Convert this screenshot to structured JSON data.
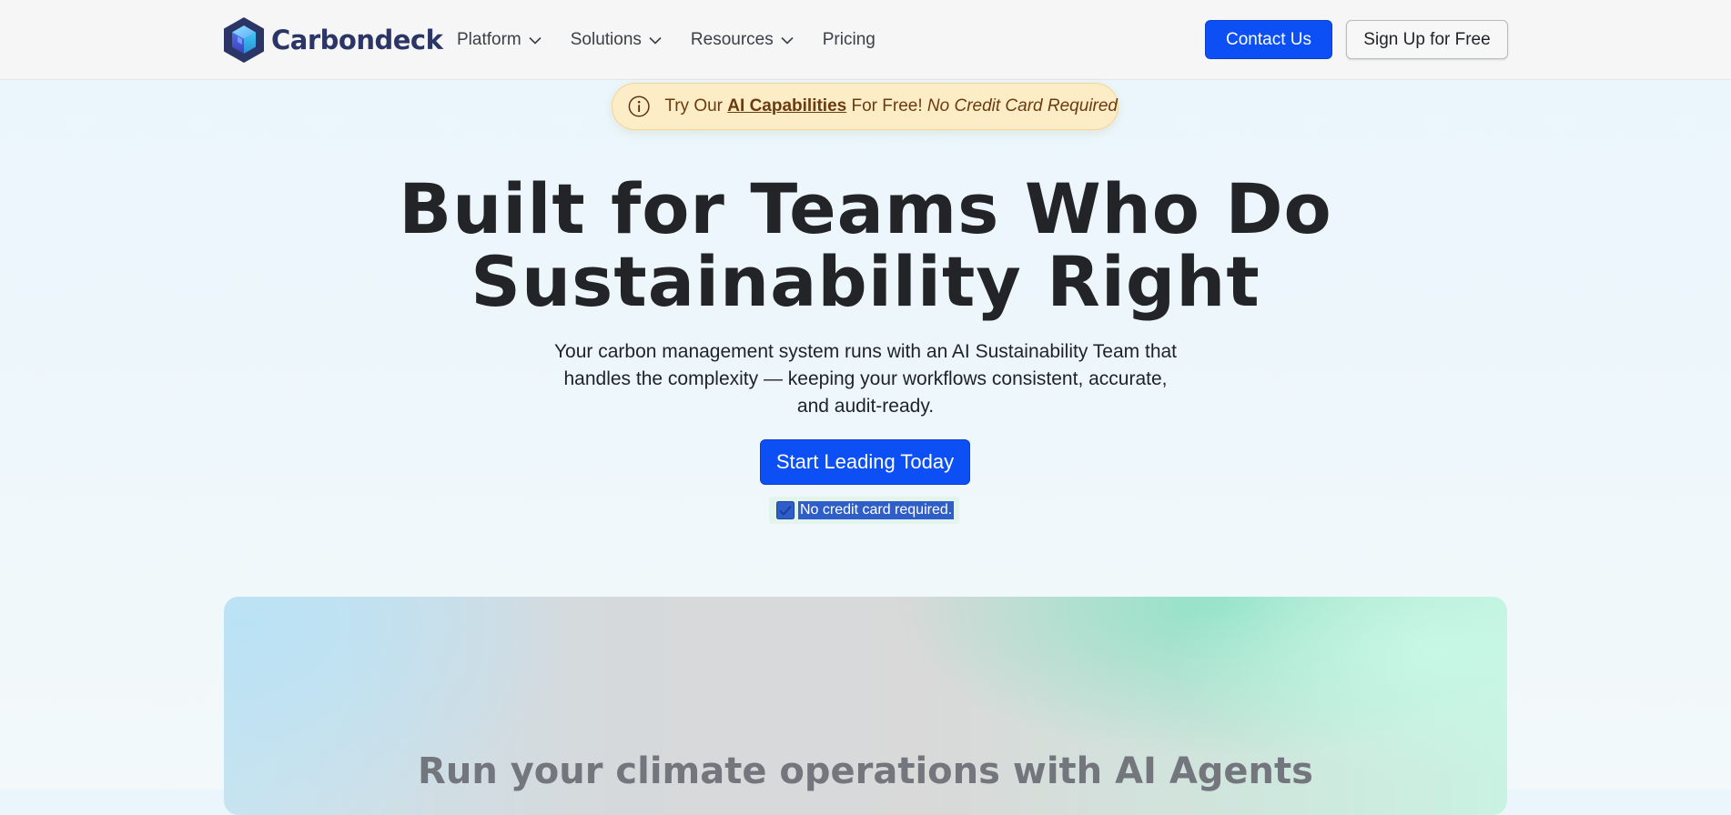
{
  "brand": {
    "name": "Carbondeck",
    "icon": "hexagon-cube-logo"
  },
  "nav": {
    "items": [
      {
        "label": "Platform",
        "has_dropdown": true
      },
      {
        "label": "Solutions",
        "has_dropdown": true
      },
      {
        "label": "Resources",
        "has_dropdown": true
      },
      {
        "label": "Pricing",
        "has_dropdown": false
      }
    ],
    "contact_label": "Contact Us",
    "signup_label": "Sign Up for Free"
  },
  "announcement": {
    "icon": "info-icon",
    "prefix": "Try Our ",
    "link": "AI Capabilities",
    "middle": " For Free! ",
    "emphasis": "No Credit Card Required"
  },
  "hero": {
    "title_line1": "Built for Teams Who Do",
    "title_line2": "Sustainability Right",
    "subtitle": "Your carbon management system runs with an AI Sustainability Team that handles the complexity — keeping your workflows consistent, accurate, and audit-ready.",
    "cta_label": "Start Leading Today",
    "note": "No credit card required.",
    "note_icon": "check-icon"
  },
  "showcase": {
    "title": "Run your climate operations with AI Agents"
  },
  "colors": {
    "primary": "#0b4ff5",
    "brand_text": "#2b3566",
    "announcement_bg": "#fdedc7",
    "announcement_text": "#6b3b10",
    "heading": "#222428"
  }
}
